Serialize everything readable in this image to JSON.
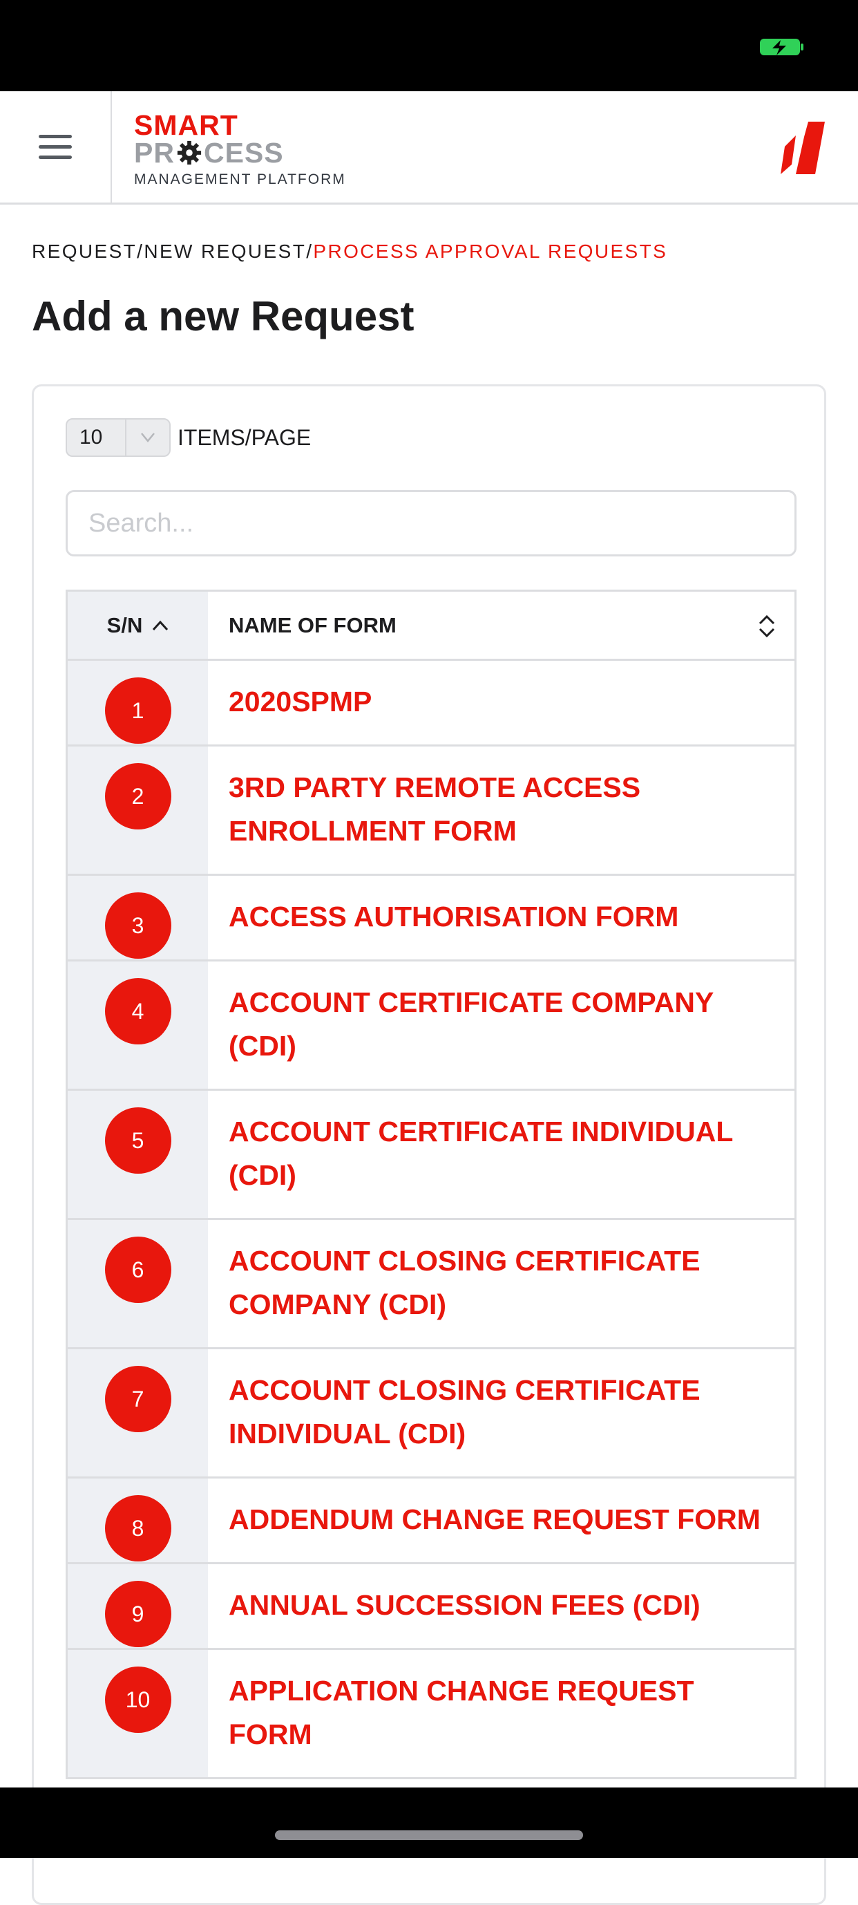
{
  "header": {
    "logo_line1": "SMART",
    "logo_line2_a": "PR",
    "logo_line2_b": "CESS",
    "logo_subtitle": "MANAGEMENT PLATFORM"
  },
  "breadcrumb": {
    "part1": "REQUEST/",
    "part2": "NEW REQUEST/",
    "active": "PROCESS APPROVAL REQUESTS"
  },
  "page_title": "Add a new Request",
  "controls": {
    "page_size": "10",
    "items_label": "ITEMS/PAGE",
    "search_placeholder": "Search..."
  },
  "table": {
    "col_sn": "S/N",
    "col_name": "NAME OF FORM",
    "rows": [
      {
        "sn": "1",
        "name": "2020SPMP"
      },
      {
        "sn": "2",
        "name": "3RD PARTY REMOTE ACCESS ENROLLMENT FORM"
      },
      {
        "sn": "3",
        "name": "ACCESS AUTHORISATION FORM"
      },
      {
        "sn": "4",
        "name": "ACCOUNT CERTIFICATE COMPANY (CDI)"
      },
      {
        "sn": "5",
        "name": "ACCOUNT CERTIFICATE INDIVIDUAL (CDI)"
      },
      {
        "sn": "6",
        "name": "ACCOUNT CLOSING CERTIFICATE COMPANY (CDI)"
      },
      {
        "sn": "7",
        "name": "ACCOUNT CLOSING CERTIFICATE INDIVIDUAL (CDI)"
      },
      {
        "sn": "8",
        "name": "ADDENDUM CHANGE REQUEST FORM"
      },
      {
        "sn": "9",
        "name": "ANNUAL SUCCESSION FEES (CDI)"
      },
      {
        "sn": "10",
        "name": "APPLICATION CHANGE REQUEST FORM"
      }
    ]
  },
  "colors": {
    "accent": "#e8170d",
    "text": "#1d1d1f",
    "sn_column_bg": "#eef0f4",
    "battery": "#30d158"
  },
  "icons": {
    "menu": "hamburger-menu-icon",
    "brand": "brand-logo-icon",
    "sort": "sort-updown-icon",
    "sn_sort": "chevron-up-icon",
    "caret": "chevron-down-icon",
    "battery": "battery-charging-icon"
  }
}
